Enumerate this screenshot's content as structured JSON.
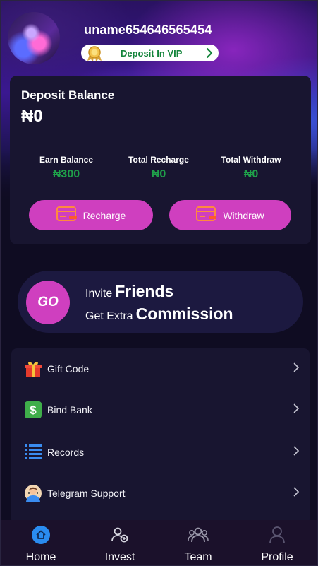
{
  "user": {
    "username": "uname654646565454",
    "vip_label": "Deposit In VIP"
  },
  "balance": {
    "title": "Deposit Balance",
    "value": "₦0",
    "stats": [
      {
        "label": "Earn Balance",
        "value": "₦300"
      },
      {
        "label": "Total Recharge",
        "value": "₦0"
      },
      {
        "label": "Total Withdraw",
        "value": "₦0"
      }
    ],
    "recharge_label": "Recharge",
    "withdraw_label": "Withdraw"
  },
  "invite": {
    "go": "GO",
    "line1_prefix": "Invite",
    "line1_bold": "Friends",
    "line2_prefix": "Get Extra",
    "line2_bold": "Commission"
  },
  "menu": [
    {
      "label": "Gift Code",
      "icon": "gift-icon"
    },
    {
      "label": "Bind Bank",
      "icon": "dollar-icon"
    },
    {
      "label": "Records",
      "icon": "list-icon"
    },
    {
      "label": "Telegram Support",
      "icon": "support-agent-icon"
    }
  ],
  "nav": [
    {
      "label": "Home",
      "icon": "home-icon",
      "active": true
    },
    {
      "label": "Invest",
      "icon": "invest-icon"
    },
    {
      "label": "Team",
      "icon": "team-icon"
    },
    {
      "label": "Profile",
      "icon": "profile-icon"
    }
  ],
  "colors": {
    "accent": "#cf3fbf",
    "success": "#1fa04a",
    "card": "#181530",
    "background": "#0f0c22",
    "nav_active": "#2a8cf0"
  }
}
